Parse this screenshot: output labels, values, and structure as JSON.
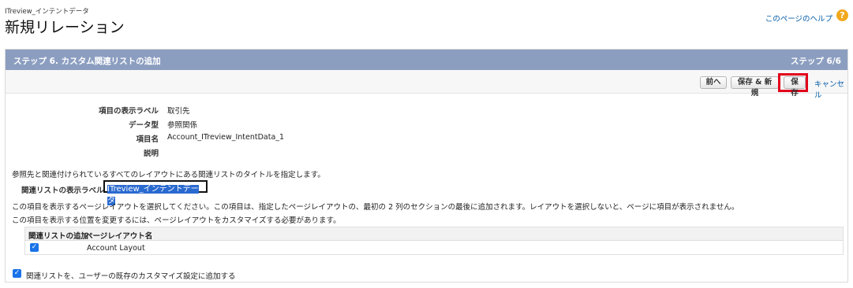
{
  "header": {
    "object_label": "ITreview_インテントデータ",
    "title": "新規リレーション",
    "help_link": "このページのヘルプ",
    "help_icon": "question-icon"
  },
  "step": {
    "title": "ステップ 6. カスタム関連リストの追加",
    "count": "ステップ 6/6"
  },
  "toolbar": {
    "prev_label": "前へ",
    "save_new_label": "保存 & 新規",
    "save_label": "保存",
    "cancel_label": "キャンセル"
  },
  "fields": [
    {
      "label": "項目の表示ラベル",
      "value": "取引先"
    },
    {
      "label": "データ型",
      "value": "参照関係"
    },
    {
      "label": "項目名",
      "value": "Account_ITreview_IntentData_1"
    },
    {
      "label": "説明",
      "value": ""
    }
  ],
  "related_list": {
    "instruction": "参照先と関連付けられているすべてのレイアウトにある関連リストのタイトルを指定します。",
    "label": "関連リストの表示ラベル",
    "value": "ITreview_インテントデータ"
  },
  "layout_instructions": [
    "この項目を表示するページレイアウトを選択してください。この項目は、指定したページレイアウトの、最初の 2 列のセクションの最後に追加されます。レイアウトを選択しないと、ページに項目が表示されません。",
    "この項目を表示する位置を変更するには、ページレイアウトをカスタマイズする必要があります。"
  ],
  "layout_table": {
    "columns": [
      "関連リストの追加",
      "ページレイアウト名"
    ],
    "rows": [
      {
        "checked": true,
        "name": "Account Layout"
      }
    ]
  },
  "bottom_option": {
    "checked": true,
    "label": "関連リストを、ユーザーの既存のカスタマイズ設定に追加する"
  },
  "colors": {
    "step_bar": "#8c9ec0",
    "link": "#015ba7",
    "highlight": "#e2001a",
    "checkbox": "#1a73e8"
  }
}
